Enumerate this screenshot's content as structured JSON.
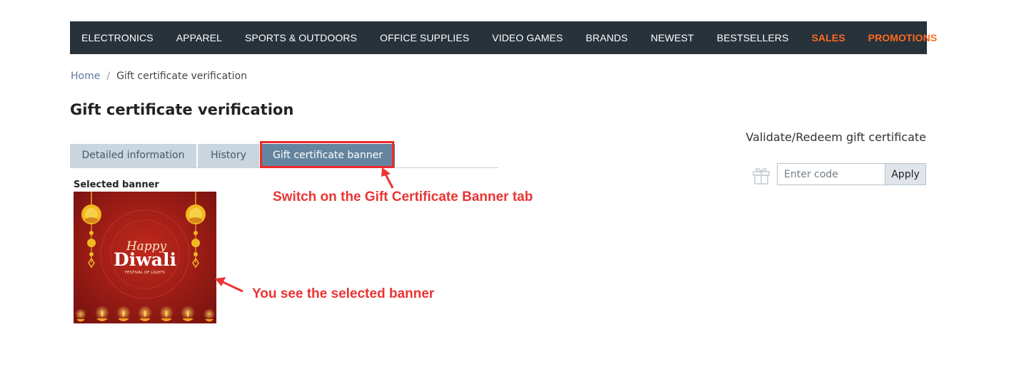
{
  "nav": {
    "items": [
      {
        "label": "ELECTRONICS"
      },
      {
        "label": "APPAREL"
      },
      {
        "label": "SPORTS & OUTDOORS"
      },
      {
        "label": "OFFICE SUPPLIES"
      },
      {
        "label": "VIDEO GAMES"
      },
      {
        "label": "BRANDS"
      },
      {
        "label": "NEWEST"
      },
      {
        "label": "BESTSELLERS"
      },
      {
        "label": "SALES"
      },
      {
        "label": "PROMOTIONS"
      }
    ],
    "accent_color": "#ff6a1f",
    "background": "#27323b"
  },
  "breadcrumb": {
    "home": "Home",
    "separator": "/",
    "current": "Gift certificate verification"
  },
  "page": {
    "title": "Gift certificate verification"
  },
  "tabs": [
    {
      "label": "Detailed information",
      "active": false
    },
    {
      "label": "History",
      "active": false
    },
    {
      "label": "Gift certificate banner",
      "active": true
    }
  ],
  "banner": {
    "section_label": "Selected banner",
    "image_text": {
      "line1": "Happy",
      "line2": "Diwali",
      "line3": "FESTIVAL OF LIGHTS"
    }
  },
  "annotations": {
    "tab_hint": "Switch on the Gift Certificate Banner tab",
    "banner_hint": "You see the selected banner",
    "color": "#ea3434"
  },
  "redeem": {
    "title": "Validate/Redeem gift certificate",
    "input_placeholder": "Enter code",
    "apply_label": "Apply",
    "icon": "gift-icon"
  }
}
